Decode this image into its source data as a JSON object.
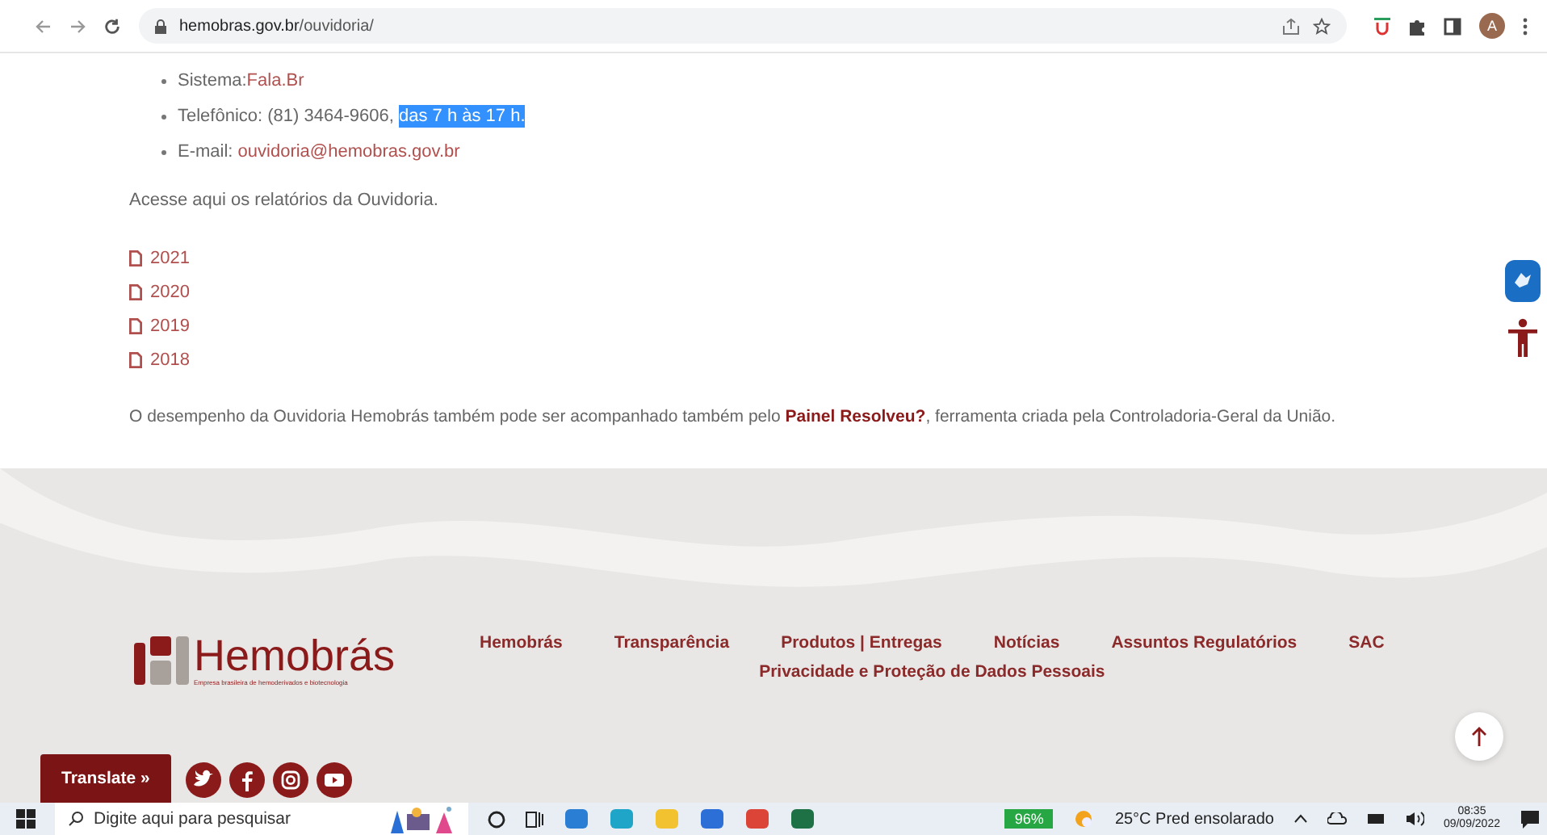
{
  "browser": {
    "url_host": "hemobras.gov.br",
    "url_path": "/ouvidoria/",
    "avatar": "A"
  },
  "contacts": [
    {
      "label": "Sistema:",
      "link": "Fala.Br"
    },
    {
      "label": "Telefônico: (81) 3464-9606, ",
      "highlighted": "das 7 h às 17 h."
    },
    {
      "label": "E-mail: ",
      "link": "ouvidoria@hemobras.gov.br"
    }
  ],
  "reports_intro": "Acesse aqui os relatórios da Ouvidoria.",
  "reports": [
    "2021",
    "2020",
    "2019",
    "2018"
  ],
  "paragraph": "O desempenho da Ouvidoria Hemobrás também pode ser acompanhado também pelo **Painel Resolveu?**, ferramenta criada pela Controladoria-Geral da União.",
  "footer": {
    "logo_name": "Hemobrás",
    "logo_tagline": "Empresa brasileira de hemoderivados e biotecnologia",
    "nav": [
      [
        "Hemobrás",
        "Transparência",
        "Produtos | Entregas",
        "Notícias",
        "Assuntos Regulatórios",
        "SAC"
      ],
      [
        "Privacidade e Proteção de Dados Pessoais"
      ]
    ],
    "translate": "Translate »",
    "social": [
      {
        "kind": "twitter"
      },
      {
        "kind": "facebook"
      },
      {
        "kind": "instagram"
      },
      {
        "kind": "youtube"
      }
    ]
  },
  "taskbar": {
    "search_placeholder": "Digite aqui para pesquisar",
    "apps": [
      {
        "kind": "mail"
      },
      {
        "kind": "edge"
      },
      {
        "kind": "folder"
      },
      {
        "kind": "l"
      },
      {
        "kind": "chrome"
      },
      {
        "kind": "excel"
      }
    ],
    "battery": "96%",
    "weather": "25°C  Pred ensolarado",
    "time": "08:35",
    "date": "09/09/2022"
  }
}
